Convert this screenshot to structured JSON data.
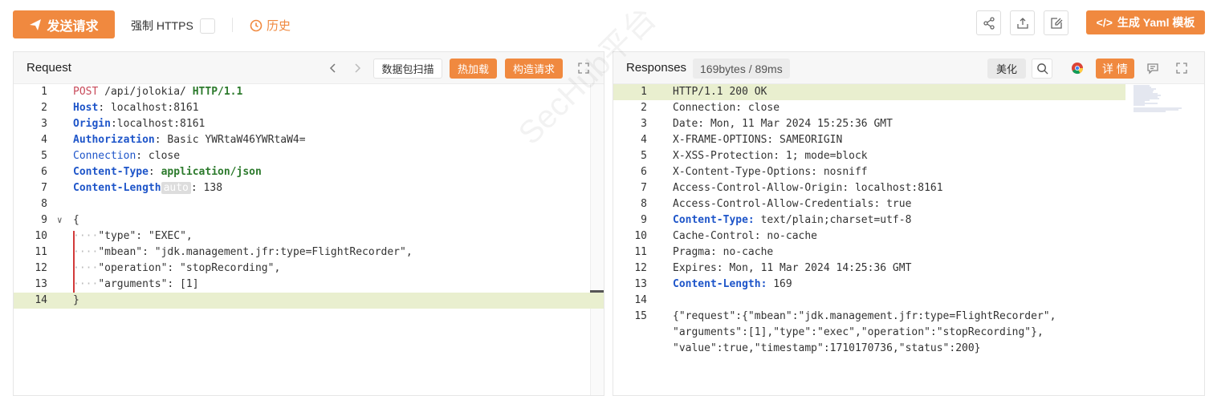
{
  "toolbar": {
    "send_label": "发送请求",
    "https_label": "强制 HTTPS",
    "history_label": "历史",
    "yaml_label": "生成 Yaml 模板",
    "yaml_prefix": "</>"
  },
  "request": {
    "title": "Request",
    "packet_scan": "数据包扫描",
    "hot_load": "热加载",
    "build_request": "构造请求",
    "lines": [
      {
        "n": "1",
        "parts": [
          [
            "POST",
            "red"
          ],
          [
            " /api/jolokia/ ",
            "plain"
          ],
          [
            "HTTP/1.1",
            "green"
          ]
        ]
      },
      {
        "n": "2",
        "parts": [
          [
            "Host",
            "blue"
          ],
          [
            ": localhost:8161",
            "plain"
          ]
        ]
      },
      {
        "n": "3",
        "parts": [
          [
            "Origin",
            "blue"
          ],
          [
            ":localhost:8161",
            "plain"
          ]
        ]
      },
      {
        "n": "4",
        "parts": [
          [
            "Authorization",
            "blue"
          ],
          [
            ": Basic YWRtaW46YWRtaW4=",
            "plain"
          ]
        ]
      },
      {
        "n": "5",
        "parts": [
          [
            "Connection",
            "bluen"
          ],
          [
            ": close",
            "plain"
          ]
        ]
      },
      {
        "n": "6",
        "parts": [
          [
            "Content-Type",
            "blue"
          ],
          [
            ": ",
            "plain"
          ],
          [
            "application/json",
            "green"
          ]
        ]
      },
      {
        "n": "7",
        "parts": [
          [
            "Content-Length",
            "blue"
          ],
          [
            "auto",
            "auto"
          ],
          [
            ": 138",
            "plain"
          ]
        ]
      },
      {
        "n": "8",
        "parts": []
      },
      {
        "n": "9",
        "parts": [
          [
            "{",
            "plain"
          ]
        ]
      },
      {
        "n": "10",
        "parts": [
          [
            "····",
            "dot"
          ],
          [
            "\"type\"",
            "plain"
          ],
          [
            ": \"EXEC\",",
            "plain"
          ]
        ]
      },
      {
        "n": "11",
        "parts": [
          [
            "····",
            "dot"
          ],
          [
            "\"mbean\"",
            "plain"
          ],
          [
            ": \"jdk.management.jfr:type=FlightRecorder\",",
            "plain"
          ]
        ]
      },
      {
        "n": "12",
        "parts": [
          [
            "····",
            "dot"
          ],
          [
            "\"operation\"",
            "plain"
          ],
          [
            ": \"stopRecording\",",
            "plain"
          ]
        ]
      },
      {
        "n": "13",
        "parts": [
          [
            "····",
            "dot"
          ],
          [
            "\"arguments\"",
            "plain"
          ],
          [
            ": [1]",
            "plain"
          ]
        ]
      },
      {
        "n": "14",
        "parts": [
          [
            "}",
            "plain"
          ]
        ]
      }
    ]
  },
  "response": {
    "title": "Responses",
    "size": "169bytes / 89ms",
    "beautify": "美化",
    "details": "详 情",
    "lines": [
      {
        "n": "1",
        "parts": [
          [
            "HTTP/1.1 200 OK",
            "plain"
          ]
        ]
      },
      {
        "n": "2",
        "parts": [
          [
            "Connection: close",
            "plain"
          ]
        ]
      },
      {
        "n": "3",
        "parts": [
          [
            "Date: Mon, 11 Mar 2024 15:25:36 GMT",
            "plain"
          ]
        ]
      },
      {
        "n": "4",
        "parts": [
          [
            "X-FRAME-OPTIONS: SAMEORIGIN",
            "plain"
          ]
        ]
      },
      {
        "n": "5",
        "parts": [
          [
            "X-XSS-Protection: 1; mode=block",
            "plain"
          ]
        ]
      },
      {
        "n": "6",
        "parts": [
          [
            "X-Content-Type-Options: nosniff",
            "plain"
          ]
        ]
      },
      {
        "n": "7",
        "parts": [
          [
            "Access-Control-Allow-Origin: localhost:8161",
            "plain"
          ]
        ]
      },
      {
        "n": "8",
        "parts": [
          [
            "Access-Control-Allow-Credentials: true",
            "plain"
          ]
        ]
      },
      {
        "n": "9",
        "parts": [
          [
            "Content-Type:",
            "blue"
          ],
          [
            " text/plain;charset=utf-8",
            "plain"
          ]
        ]
      },
      {
        "n": "10",
        "parts": [
          [
            "Cache-Control: no-cache",
            "plain"
          ]
        ]
      },
      {
        "n": "11",
        "parts": [
          [
            "Pragma: no-cache",
            "plain"
          ]
        ]
      },
      {
        "n": "12",
        "parts": [
          [
            "Expires: Mon, 11 Mar 2024 14:25:36 GMT",
            "plain"
          ]
        ]
      },
      {
        "n": "13",
        "parts": [
          [
            "Content-Length:",
            "blue"
          ],
          [
            " 169",
            "plain"
          ]
        ]
      },
      {
        "n": "14",
        "parts": []
      },
      {
        "n": "15",
        "parts": [
          [
            "{\"request\":{\"mbean\":\"jdk.management.jfr:type=FlightRecorder\",",
            "plain"
          ]
        ]
      },
      {
        "n": "",
        "parts": [
          [
            "\"arguments\":[1],\"type\":\"exec\",\"operation\":\"stopRecording\"},",
            "plain"
          ]
        ]
      },
      {
        "n": "",
        "parts": [
          [
            "\"value\":true,\"timestamp\":1710170736,\"status\":200}",
            "plain"
          ]
        ]
      }
    ]
  },
  "watermark": "SecHub平台",
  "colors": {
    "accent": "#f0893f",
    "keyword_blue": "#1e55c9",
    "highlight": "#e9efcf"
  }
}
